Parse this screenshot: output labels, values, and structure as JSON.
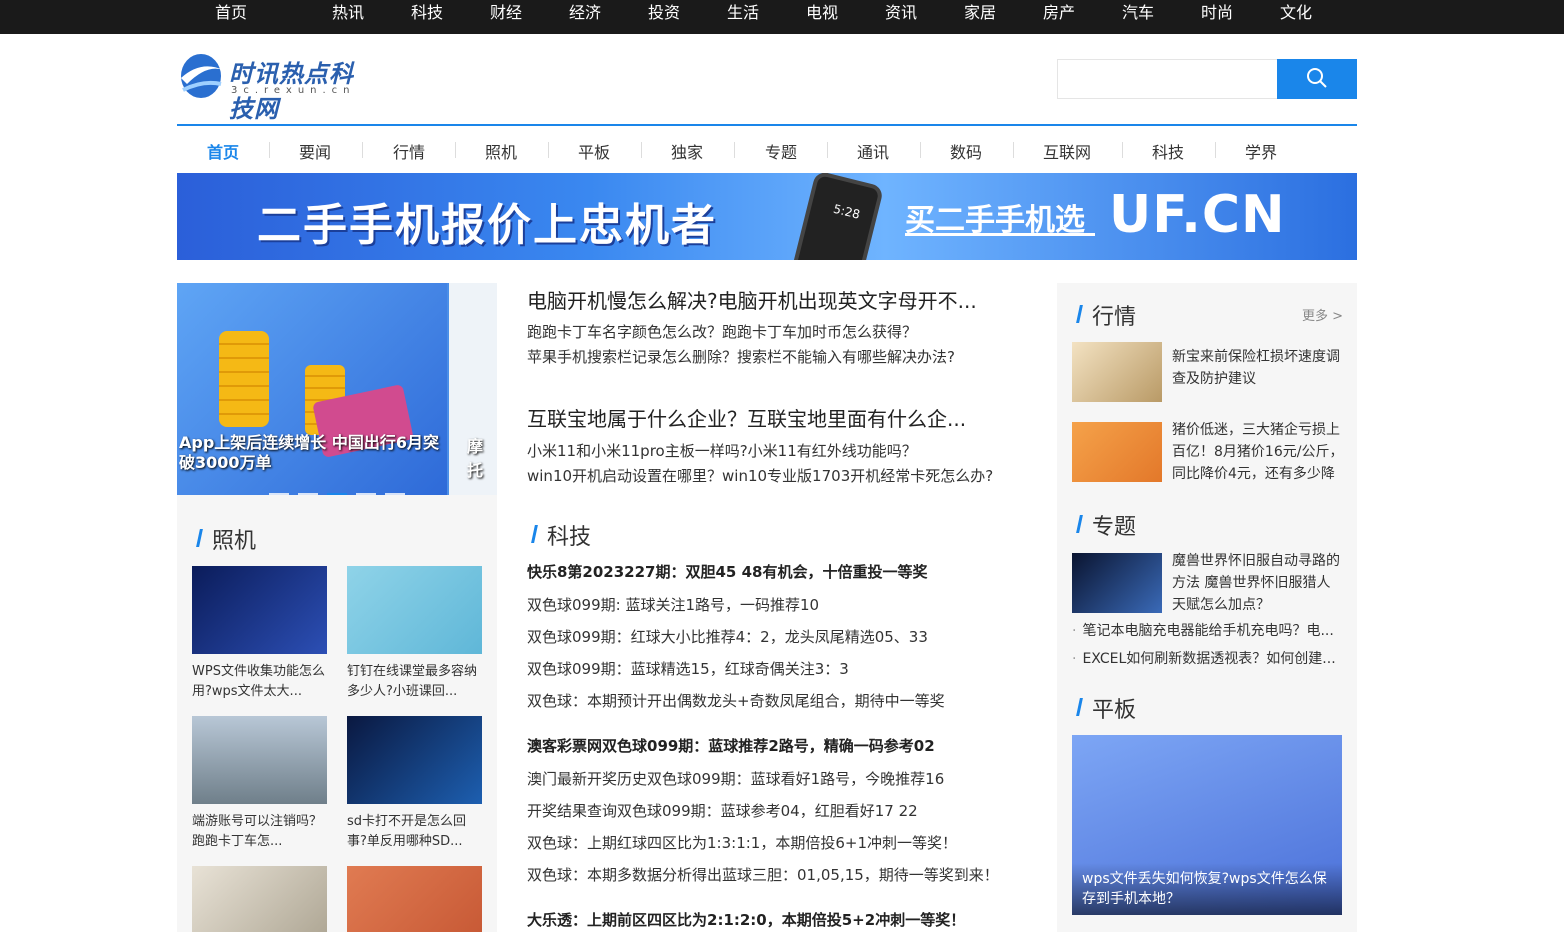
{
  "topnav": [
    "首页",
    "热讯",
    "科技",
    "财经",
    "经济",
    "投资",
    "生活",
    "电视",
    "资讯",
    "家居",
    "房产",
    "汽车",
    "时尚",
    "文化"
  ],
  "logo": {
    "title": "时讯热点科技网",
    "sub": "3c.rexun.cn"
  },
  "search": {
    "value": "",
    "placeholder": ""
  },
  "nav2": [
    "首页",
    "要闻",
    "行情",
    "照机",
    "平板",
    "独家",
    "专题",
    "通讯",
    "数码",
    "互联网",
    "科技",
    "学界"
  ],
  "banner": {
    "text1": "二手手机报价上忠机者",
    "text2": "买二手手机选",
    "text3": "UF.CN",
    "phone_time": "5:28"
  },
  "slider": {
    "caption1": "App上架后连续增长 中国出行6月突破3000万单",
    "caption2": "摩托"
  },
  "left_section": {
    "title": "照机",
    "items": [
      {
        "caption": "WPS文件收集功能怎么用?wps文件太大..."
      },
      {
        "caption": "钉钉在线课堂最多容纳多少人?小班课回..."
      },
      {
        "caption": "端游账号可以注销吗？跑跑卡丁车怎..."
      },
      {
        "caption": "sd卡打不开是怎么回事?单反用哪种SD..."
      },
      {
        "caption": ""
      },
      {
        "caption": ""
      }
    ]
  },
  "middle": {
    "headline1": "电脑开机慢怎么解决?电脑开机出现英文字母开不...",
    "sub1": [
      "跑跑卡丁车名字颜色怎么改？跑跑卡丁车加时币怎么获得？",
      "苹果手机搜索栏记录怎么删除？搜索栏不能输入有哪些解决办法?"
    ],
    "headline2": "互联宝地属于什么企业？互联宝地里面有什么企...",
    "sub2": [
      "小米11和小米11pro主板一样吗?小米11有红外线功能吗？",
      "win10开机启动设置在哪里？win10专业版1703开机经常卡死怎么办?"
    ],
    "section_title": "科技",
    "groups": [
      {
        "lead": "快乐8第2023227期：双胆45 48有机会，十倍重投一等奖",
        "lines": [
          "双色球099期: 蓝球关注1路号，一码推荐10",
          "双色球099期：红球大小比推荐4：2，龙头凤尾精选05、33",
          "双色球099期：蓝球精选15，红球奇偶关注3：3",
          "双色球：本期预计开出偶数龙头+奇数凤尾组合，期待中一等奖"
        ]
      },
      {
        "lead": "澳客彩票网双色球099期：蓝球推荐2路号，精确一码参考02",
        "lines": [
          "澳门最新开奖历史双色球099期：蓝球看好1路号，今晚推荐16",
          "开奖结果查询双色球099期：蓝球参考04，红胆看好17 22",
          "双色球：上期红球四区比为1:3:1:1，本期倍投6+1冲刺一等奖！",
          "双色球：本期多数据分析得出蓝球三胆：01,05,15，期待一等奖到来！"
        ]
      },
      {
        "lead": "大乐透：上期前区四区比为2:1:2:0，本期倍投5+2冲刺一等奖！",
        "lines": []
      }
    ]
  },
  "right": {
    "sec1": {
      "title": "行情",
      "more": "更多 >",
      "items": [
        "新宝来前保险杠损坏速度调查及防护建议",
        "猪价低迷，三大猪企亏损上百亿！8月猪价16元/公斤，同比降价4元，还有多少降"
      ]
    },
    "sec2": {
      "title": "专题",
      "item": "魔兽世界怀旧服自动寻路的方法 魔兽世界怀旧服猎人天赋怎么加点？",
      "list": [
        "笔记本电脑充电器能给手机充电吗？电...",
        "EXCEL如何刷新数据透视表？如何创建..."
      ]
    },
    "sec3": {
      "title": "平板",
      "caption": "wps文件丢失如何恢复?wps文件怎么保存到手机本地？"
    }
  },
  "colors": {
    "accent": "#1a86ea",
    "topbar": "#1a1a1a"
  }
}
